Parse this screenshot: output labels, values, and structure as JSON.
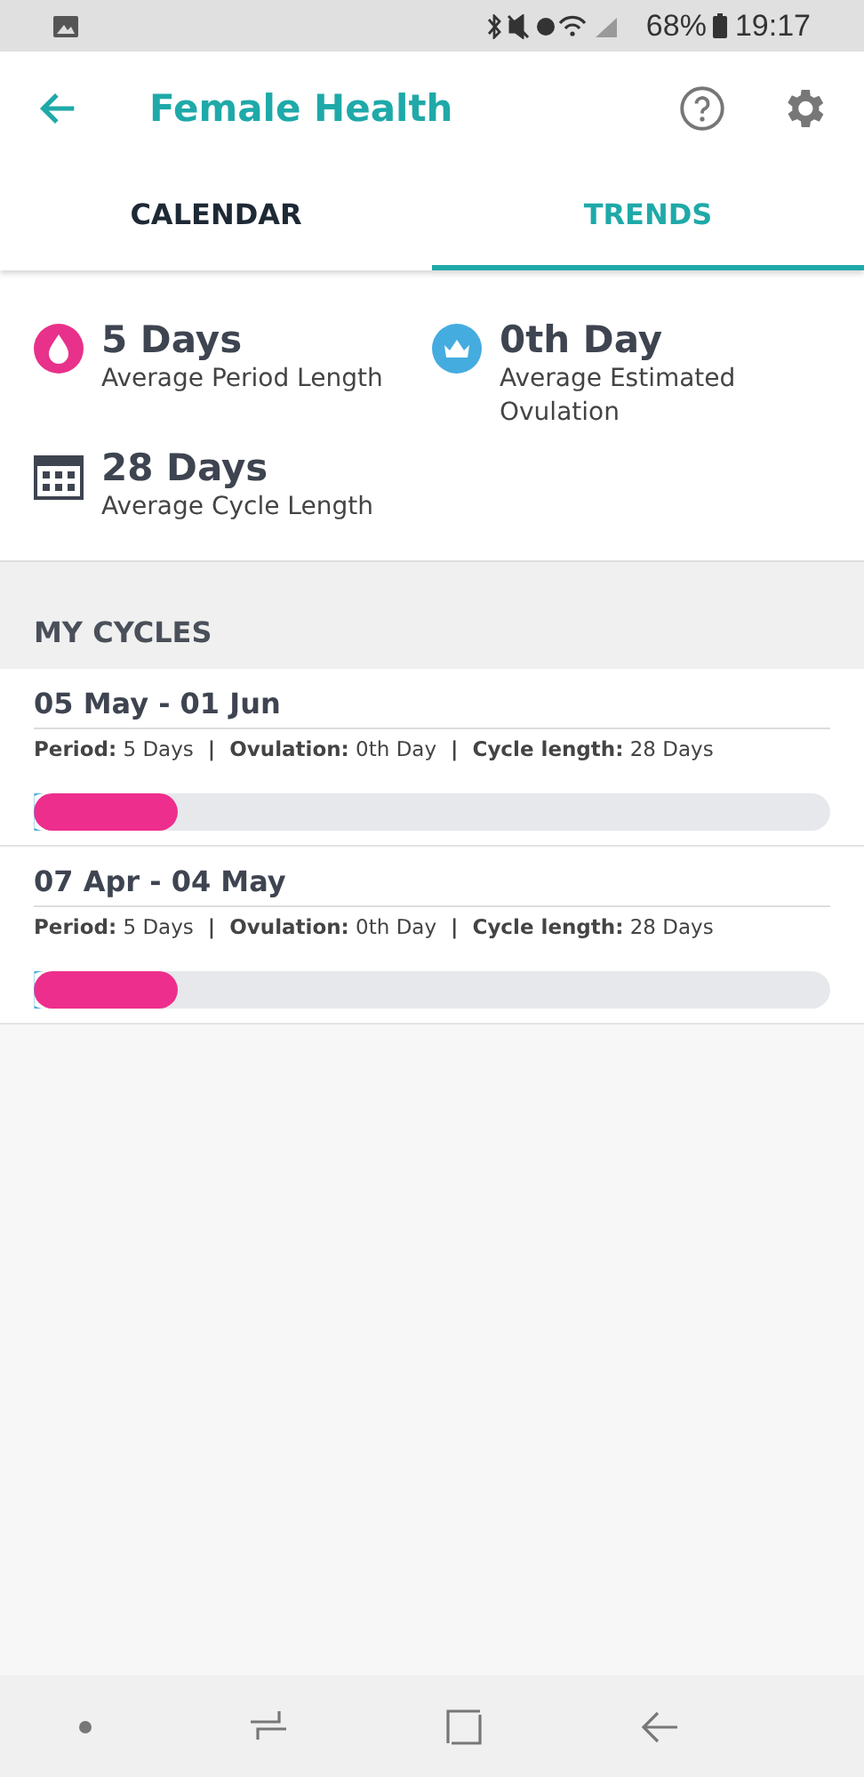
{
  "status_bar": {
    "battery": "68%",
    "time": "19:17"
  },
  "header": {
    "title": "Female Health"
  },
  "tabs": [
    {
      "label": "CALENDAR",
      "selected": false
    },
    {
      "label": "TRENDS",
      "selected": true
    }
  ],
  "stats": [
    {
      "kind": "period",
      "value": "5 Days",
      "label": "Average Period Length"
    },
    {
      "kind": "ovulation",
      "value": "0th Day",
      "label": "Average Estimated Ovulation"
    },
    {
      "kind": "cycle",
      "value": "28 Days",
      "label": "Average Cycle Length"
    }
  ],
  "cycles_section": {
    "title": "MY CYCLES"
  },
  "cycles": [
    {
      "range": "05 May - 01 Jun",
      "details": [
        "**Period:** 5 Days",
        "**Ovulation:** 0th Day",
        "**Cycle length:** 28 Days"
      ],
      "separator": "|",
      "level": 0.18
    },
    {
      "range": "07 Apr - 04 May",
      "details": [
        "**Period:** 5 Days",
        "**Ovulation:** 0th Day",
        "**Cycle length:** 28 Days"
      ],
      "separator": "|",
      "level": 0.18
    }
  ]
}
